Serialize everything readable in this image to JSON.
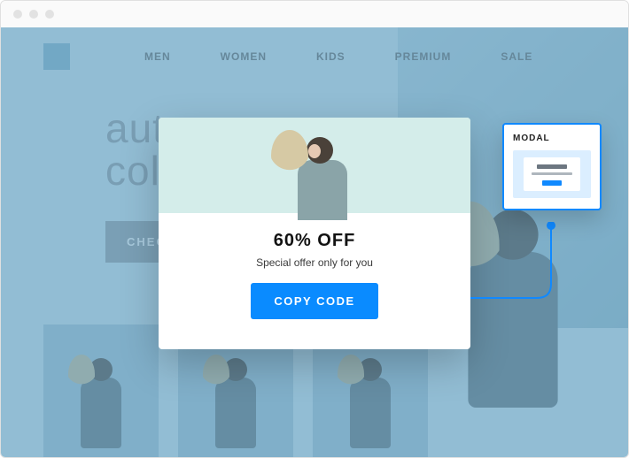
{
  "nav": {
    "items": [
      "MEN",
      "WOMEN",
      "KIDS",
      "PREMIUM",
      "SALE"
    ]
  },
  "hero": {
    "title_line1": "autumn",
    "title_line2": "collection",
    "cta": "CHECK"
  },
  "modal": {
    "headline": "60% OFF",
    "subtext": "Special offer only for you",
    "button": "COPY CODE"
  },
  "badge": {
    "label": "MODAL"
  }
}
